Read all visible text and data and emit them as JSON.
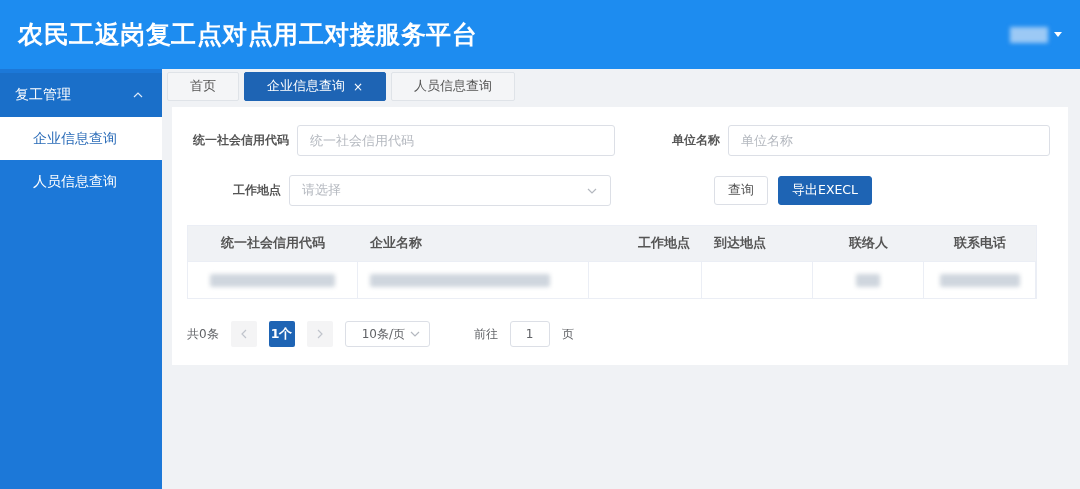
{
  "header": {
    "title": "农民工返岗复工点对点用工对接服务平台"
  },
  "sidebar": {
    "group": {
      "label": "复工管理",
      "expanded": true
    },
    "items": [
      {
        "label": "企业信息查询",
        "selected": true
      },
      {
        "label": "人员信息查询",
        "selected": false
      }
    ]
  },
  "tabs": [
    {
      "label": "首页",
      "selected": false,
      "closable": false
    },
    {
      "label": "企业信息查询",
      "selected": true,
      "closable": true,
      "close": "×"
    },
    {
      "label": "人员信息查询",
      "selected": false,
      "closable": false
    }
  ],
  "form": {
    "credit_code": {
      "label": "统一社会信用代码",
      "placeholder": "统一社会信用代码"
    },
    "unit_name": {
      "label": "单位名称",
      "placeholder": "单位名称"
    },
    "work_place": {
      "label": "工作地点",
      "placeholder": "请选择"
    },
    "buttons": [
      {
        "label": "查询",
        "kind": "plain"
      },
      {
        "label": "导出EXECL",
        "kind": "primary"
      }
    ]
  },
  "table": {
    "columns": [
      "统一社会信用代码",
      "企业名称",
      "工作地点",
      "到达地点",
      "联络人",
      "联系电话"
    ]
  },
  "pagination": {
    "total": "共0条",
    "pages": [
      {
        "label": "1个",
        "selected": true
      }
    ],
    "prev_disabled": true,
    "next_disabled": true,
    "page_size": "10条/页",
    "goto_label": "前往",
    "goto_value": "1",
    "goto_suffix": "页"
  }
}
